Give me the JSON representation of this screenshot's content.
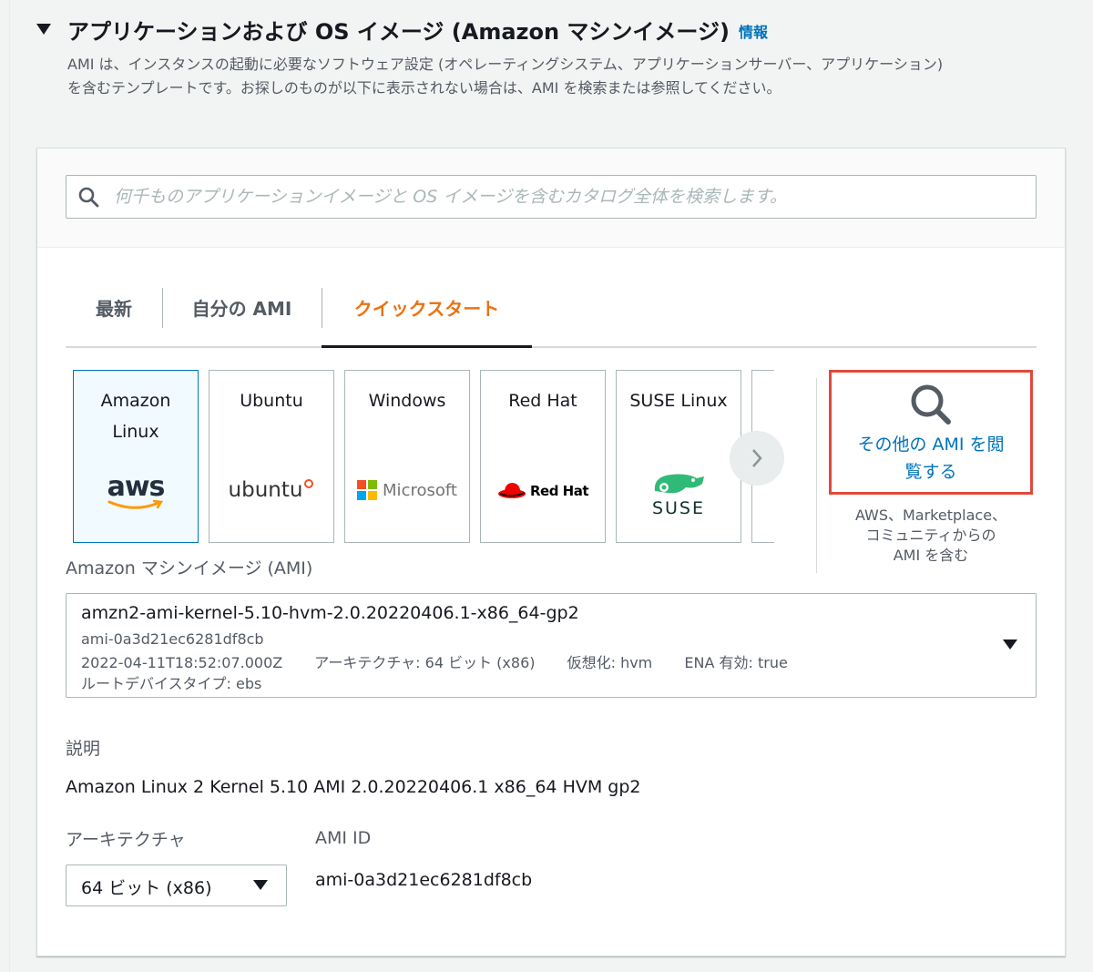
{
  "section": {
    "title": "アプリケーションおよび OS イメージ (Amazon マシンイメージ)",
    "info_link": "情報",
    "description_line1": "AMI は、インスタンスの起動に必要なソフトウェア設定 (オペレーティングシステム、アプリケーションサーバー、アプリケーション)",
    "description_line2": "を含むテンプレートです。お探しのものが以下に表示されない場合は、AMI を検索または参照してください。"
  },
  "search": {
    "placeholder": "何千ものアプリケーションイメージと OS イメージを含むカタログ全体を検索します。",
    "value": ""
  },
  "tabs": [
    {
      "label": "最新",
      "active": false
    },
    {
      "label": "自分の AMI",
      "active": false
    },
    {
      "label": "クイックスタート",
      "active": true
    }
  ],
  "os_cards": [
    {
      "name_line1": "Amazon",
      "name_line2": "Linux",
      "logo_text": "aws",
      "selected": true
    },
    {
      "name_line1": "Ubuntu",
      "name_line2": "",
      "logo_text": "ubuntu",
      "selected": false
    },
    {
      "name_line1": "Windows",
      "name_line2": "",
      "logo_text": "Microsoft",
      "selected": false
    },
    {
      "name_line1": "Red Hat",
      "name_line2": "",
      "logo_text": "Red Hat",
      "selected": false
    },
    {
      "name_line1": "SUSE Linux",
      "name_line2": "",
      "logo_text": "SUSE",
      "selected": false
    }
  ],
  "browse": {
    "link_line1": "その他の AMI を閲",
    "link_line2": "覧する",
    "note_line1": "AWS、Marketplace、",
    "note_line2": "コミュニティからの",
    "note_line3": "AMI を含む"
  },
  "ami": {
    "label": "Amazon マシンイメージ (AMI)",
    "name": "amzn2-ami-kernel-5.10-hvm-2.0.20220406.1-x86_64-gp2",
    "id": "ami-0a3d21ec6281df8cb",
    "date": "2022-04-11T18:52:07.000Z",
    "architecture": "アーキテクチャ: 64 ビット (x86)",
    "virtualization": "仮想化: hvm",
    "ena": "ENA 有効: true",
    "root_device": "ルートデバイスタイプ: ebs"
  },
  "details": {
    "description_label": "説明",
    "description_value": "Amazon Linux 2 Kernel 5.10 AMI 2.0.20220406.1 x86_64 HVM gp2",
    "architecture_label": "アーキテクチャ",
    "architecture_value": "64 ビット (x86)",
    "ami_id_label": "AMI ID",
    "ami_id_value": "ami-0a3d21ec6281df8cb"
  },
  "colors": {
    "accent_orange": "#ec7211",
    "link_blue": "#0073bb",
    "highlight_red": "#e0483c",
    "selected_bg": "#f1faff"
  }
}
